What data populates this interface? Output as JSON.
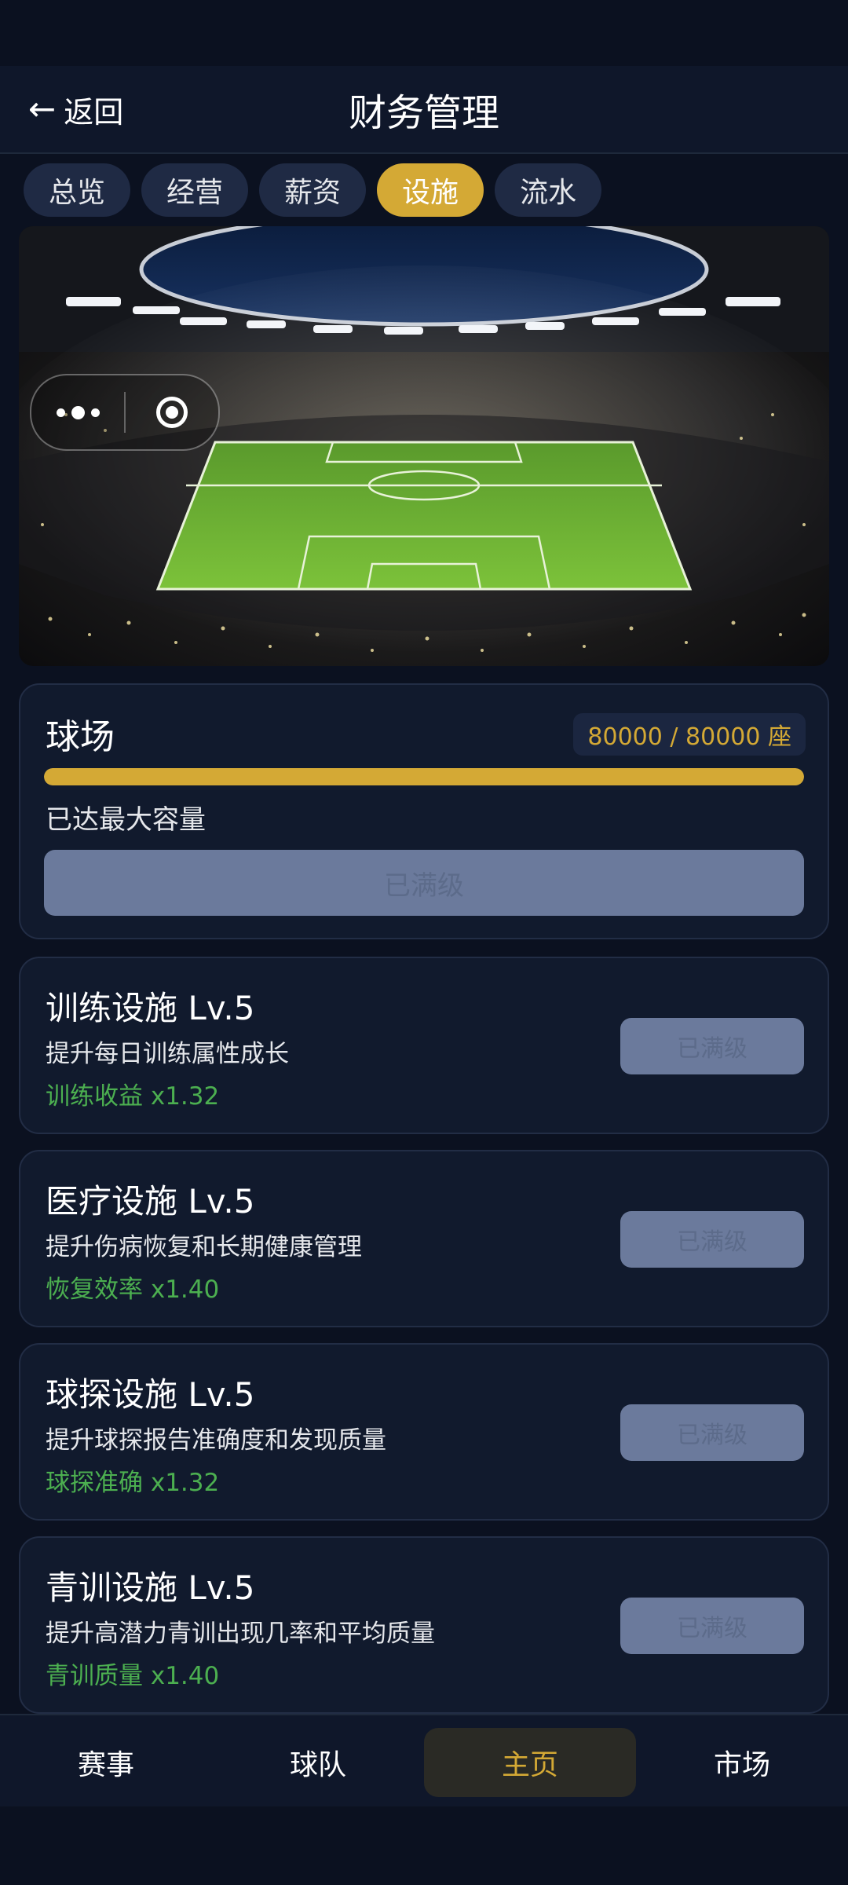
{
  "header": {
    "back_label": "返回",
    "back_icon": "←",
    "title": "财务管理"
  },
  "tabs": [
    {
      "label": "总览",
      "active": false
    },
    {
      "label": "经营",
      "active": false
    },
    {
      "label": "薪资",
      "active": false
    },
    {
      "label": "设施",
      "active": true
    },
    {
      "label": "流水",
      "active": false
    }
  ],
  "stadium": {
    "title": "球场",
    "capacity_text": "80000 / 80000 座",
    "progress_percent": 100,
    "note": "已达最大容量",
    "button_label": "已满级"
  },
  "facilities": [
    {
      "title": "训练设施 Lv.5",
      "desc": "提升每日训练属性成长",
      "bonus": "训练收益 x1.32",
      "button_label": "已满级"
    },
    {
      "title": "医疗设施 Lv.5",
      "desc": "提升伤病恢复和长期健康管理",
      "bonus": "恢复效率 x1.40",
      "button_label": "已满级"
    },
    {
      "title": "球探设施 Lv.5",
      "desc": "提升球探报告准确度和发现质量",
      "bonus": "球探准确 x1.32",
      "button_label": "已满级"
    },
    {
      "title": "青训设施 Lv.5",
      "desc": "提升高潜力青训出现几率和平均质量",
      "bonus": "青训质量 x1.40",
      "button_label": "已满级"
    }
  ],
  "nav": [
    {
      "label": "赛事",
      "active": false
    },
    {
      "label": "球队",
      "active": false
    },
    {
      "label": "主页",
      "active": true
    },
    {
      "label": "市场",
      "active": false
    }
  ],
  "colors": {
    "accent": "#d4a935",
    "bonus_green": "#4caf50",
    "background": "#0b1120",
    "card": "#111a2d",
    "disabled_button": "#6b7a9c"
  },
  "icons": {
    "back": "arrow-left-icon",
    "more": "more-dots-icon",
    "close": "target-icon"
  }
}
